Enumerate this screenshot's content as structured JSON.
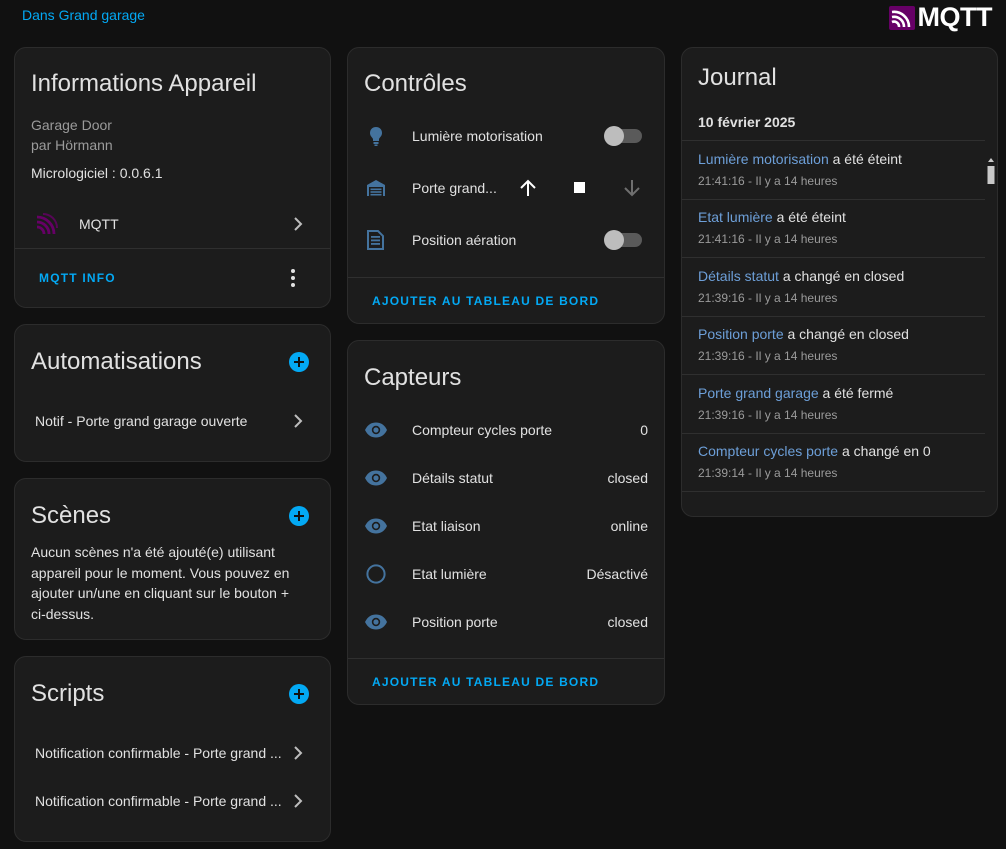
{
  "header": {
    "area_link": "Dans Grand garage",
    "logo_text": "MQTT",
    "logo_color": "#660066"
  },
  "device_info": {
    "title": "Informations Appareil",
    "model": "Garage Door",
    "manufacturer": "par Hörmann",
    "firmware": "Micrologiciel : 0.0.6.1",
    "integration": "MQTT",
    "mqtt_info_label": "MQTT INFO"
  },
  "automations": {
    "title": "Automatisations",
    "items": [
      "Notif - Porte grand garage ouverte"
    ]
  },
  "scenes": {
    "title": "Scènes",
    "empty_text": "Aucun scènes n'a été ajouté(e) utilisant appareil pour le moment. Vous pouvez en ajouter un/une en cliquant sur le bouton + ci-dessus."
  },
  "scripts": {
    "title": "Scripts",
    "items": [
      "Notification confirmable - Porte grand ...",
      "Notification confirmable - Porte grand ..."
    ]
  },
  "controls": {
    "title": "Contrôles",
    "items": [
      {
        "icon": "lightbulb-icon",
        "name": "Lumière motorisation",
        "type": "toggle",
        "on": false
      },
      {
        "icon": "garage-icon",
        "name": "Porte grand...",
        "type": "cover"
      },
      {
        "icon": "vent-icon",
        "name": "Position aération",
        "type": "toggle",
        "on": false
      }
    ],
    "add_label": "AJOUTER AU TABLEAU DE BORD"
  },
  "sensors": {
    "title": "Capteurs",
    "items": [
      {
        "icon": "eye-icon",
        "name": "Compteur cycles porte",
        "value": "0"
      },
      {
        "icon": "eye-icon",
        "name": "Détails statut",
        "value": "closed"
      },
      {
        "icon": "eye-icon",
        "name": "Etat liaison",
        "value": "online"
      },
      {
        "icon": "circle-outline-icon",
        "name": "Etat lumière",
        "value": "Désactivé"
      },
      {
        "icon": "eye-icon",
        "name": "Position porte",
        "value": "closed"
      }
    ],
    "add_label": "AJOUTER AU TABLEAU DE BORD"
  },
  "logbook": {
    "title": "Journal",
    "date": "10 février 2025",
    "entries": [
      {
        "entity": "Lumière motorisation",
        "action": "a été éteint",
        "time": "21:41:16 - Il y a 14 heures"
      },
      {
        "entity": "Etat lumière",
        "action": "a été éteint",
        "time": "21:41:16 - Il y a 14 heures"
      },
      {
        "entity": "Détails statut",
        "action": "a changé en closed",
        "time": "21:39:16 - Il y a 14 heures"
      },
      {
        "entity": "Position porte",
        "action": "a changé en closed",
        "time": "21:39:16 - Il y a 14 heures"
      },
      {
        "entity": "Porte grand garage",
        "action": "a été fermé",
        "time": "21:39:16 - Il y a 14 heures"
      },
      {
        "entity": "Compteur cycles porte",
        "action": "a changé en 0",
        "time": "21:39:14 - Il y a 14 heures"
      }
    ]
  }
}
